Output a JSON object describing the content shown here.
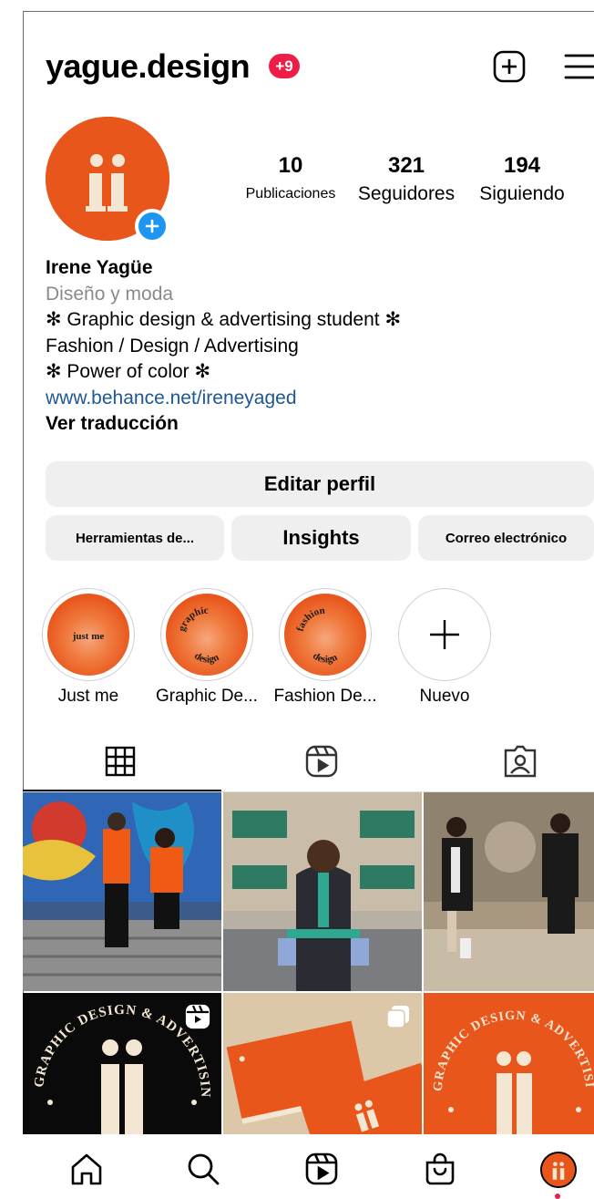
{
  "header": {
    "username": "yague.design",
    "notification_badge": "+9",
    "create_icon": "plus-square-icon",
    "menu_icon": "hamburger-menu-icon"
  },
  "profile": {
    "avatar_monogram": "ü",
    "stats": [
      {
        "value": "10",
        "label": "Publicaciones"
      },
      {
        "value": "321",
        "label": "Seguidores"
      },
      {
        "value": "194",
        "label": "Siguiendo"
      }
    ],
    "name": "Irene Yagüe",
    "category": "Diseño y moda",
    "bio_lines": [
      "✻ Graphic design & advertising student ✻",
      "Fashion / Design / Advertising",
      "✻ Power of color ✻"
    ],
    "link": "www.behance.net/ireneyaged",
    "translate": "Ver traducción"
  },
  "buttons": {
    "edit_profile": "Editar perfil",
    "tools": "Herramientas de...",
    "insights": "Insights",
    "email": "Correo electrónico"
  },
  "highlights": [
    {
      "label": "Just me",
      "cover_text": "just me"
    },
    {
      "label": "Graphic De...",
      "cover_text_top": "graphic",
      "cover_text_bottom": "design"
    },
    {
      "label": "Fashion De...",
      "cover_text_top": "fashion",
      "cover_text_bottom": "design"
    },
    {
      "label": "Nuevo",
      "cover_text": ""
    }
  ],
  "tabs": [
    {
      "name": "grid-icon",
      "active": true
    },
    {
      "name": "reels-icon",
      "active": false
    },
    {
      "name": "tagged-icon",
      "active": false
    }
  ],
  "posts": {
    "post_4_text": "GRAPHIC DESIGN & ADVERTISING",
    "post_6_text": "GRAPHIC DESIGN & ADVERTISING",
    "post_4_badge": "reels-icon",
    "post_5_badge": "carousel-icon"
  },
  "bottom_nav": [
    "home-icon",
    "search-icon",
    "reels-icon",
    "shop-icon",
    "profile-avatar"
  ],
  "colors": {
    "brand_orange": "#e8561c",
    "badge_red": "#ed1d47",
    "link_blue": "#1e5795",
    "story_blue": "#1c96f0"
  }
}
